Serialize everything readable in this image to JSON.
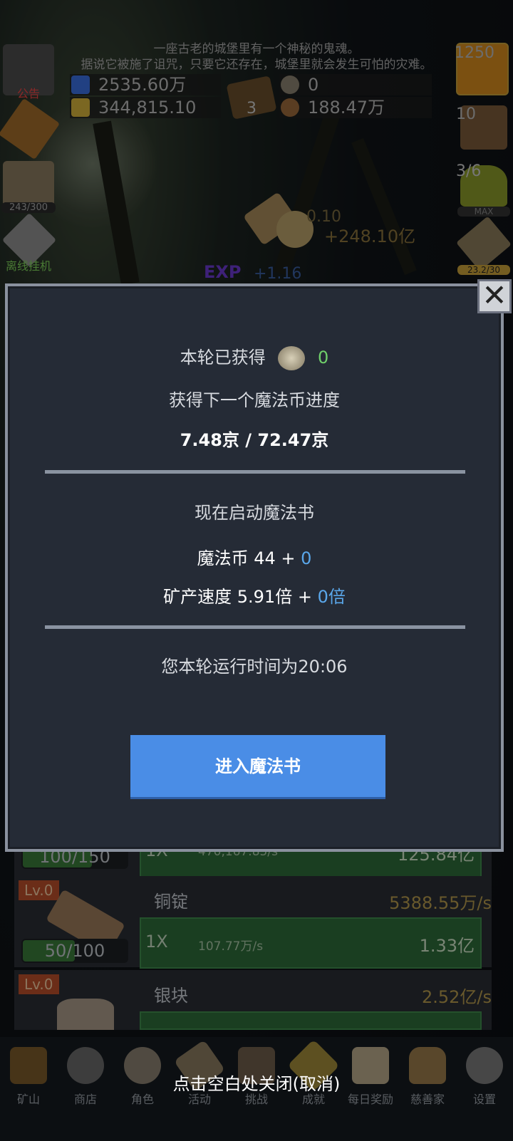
{
  "story": {
    "line1": "一座古老的城堡里有一个神秘的鬼魂。",
    "line2": "据说它被施了诅咒，只要它还存在，城堡里就会发生可怕的灾难。"
  },
  "resources": {
    "mana_potion": "2535.60万",
    "gold_potion": "344,815.10",
    "book_count": "3",
    "coin": "0",
    "bread": "188.47万"
  },
  "left_side": {
    "notice_label": "公告",
    "chef_count": "243/300",
    "offline_label": "离线挂机"
  },
  "right_side": {
    "potion_count": "1250",
    "chest_count": "10",
    "slime_count": "3/6",
    "slime_max": "MAX",
    "sword_count": "23.2/30"
  },
  "floating": {
    "coin_small": "0.10",
    "coin_gain": "+248.10亿",
    "exp_label": "EXP",
    "exp_gain": "+1.16"
  },
  "modal": {
    "earned_label": "本轮已获得",
    "earned_value": "0",
    "progress_label": "获得下一个魔法币进度",
    "progress_value": "7.48京 / 72.47京",
    "start_label": "现在启动魔法书",
    "magic_coin_label": "魔法币 44 + ",
    "magic_coin_add": "0",
    "speed_label": "矿产速度 5.91倍 + ",
    "speed_add": "0倍",
    "runtime": "您本轮运行时间为20:06",
    "enter_button": "进入魔法书"
  },
  "mine_rows": [
    {
      "level": "",
      "name": "",
      "rate": "",
      "progress": "100/150",
      "progress_fraction": 0.667,
      "multiplier": "1X",
      "per_sec": "470,167.85/s",
      "total": "125.84亿"
    },
    {
      "level": "Lv.0",
      "name": "铜锭",
      "rate": "5388.55万/s",
      "progress": "50/100",
      "progress_fraction": 0.5,
      "multiplier": "1X",
      "per_sec": "107.77万/s",
      "total": "1.33亿"
    },
    {
      "level": "Lv.0",
      "name": "银块",
      "rate": "2.52亿/s",
      "progress": "",
      "progress_fraction": 0,
      "multiplier": "",
      "per_sec": "",
      "total": ""
    }
  ],
  "bottom_nav": [
    {
      "label": "矿山",
      "icon": "lantern-icon"
    },
    {
      "label": "商店",
      "icon": "shop-icon"
    },
    {
      "label": "角色",
      "icon": "skull-icon"
    },
    {
      "label": "活动",
      "icon": "scroll-icon"
    },
    {
      "label": "挑战",
      "icon": "book-icon"
    },
    {
      "label": "成就",
      "icon": "key-icon"
    },
    {
      "label": "每日奖励",
      "icon": "envelope-icon"
    },
    {
      "label": "慈善家",
      "icon": "bread-icon"
    },
    {
      "label": "设置",
      "icon": "gear-icon"
    }
  ],
  "tap_tip": "点击空白处关闭(取消)",
  "colors": {
    "modal_bg": "#252b36",
    "button_blue": "#4a8de6",
    "green_value": "#6fcf6a",
    "blue_value": "#5aa7ea"
  }
}
